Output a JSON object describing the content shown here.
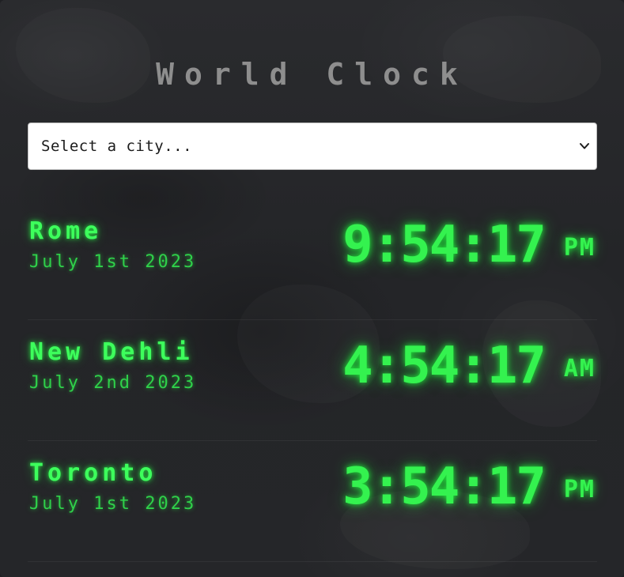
{
  "app": {
    "title": "World Clock"
  },
  "city_select": {
    "selected": "Select a city..."
  },
  "cities": [
    {
      "name": "Rome",
      "date": "July 1st 2023",
      "time": "9:54:17",
      "ampm": "PM"
    },
    {
      "name": "New Dehli",
      "date": "July 2nd 2023",
      "time": "4:54:17",
      "ampm": "AM"
    },
    {
      "name": "Toronto",
      "date": "July 1st 2023",
      "time": "3:54:17",
      "ampm": "PM"
    }
  ],
  "colors": {
    "background": "#242528",
    "title": "#8e8e8e",
    "glow_green": "#34f24f"
  },
  "icons": {
    "select_chevron": "chevron-down-icon"
  }
}
